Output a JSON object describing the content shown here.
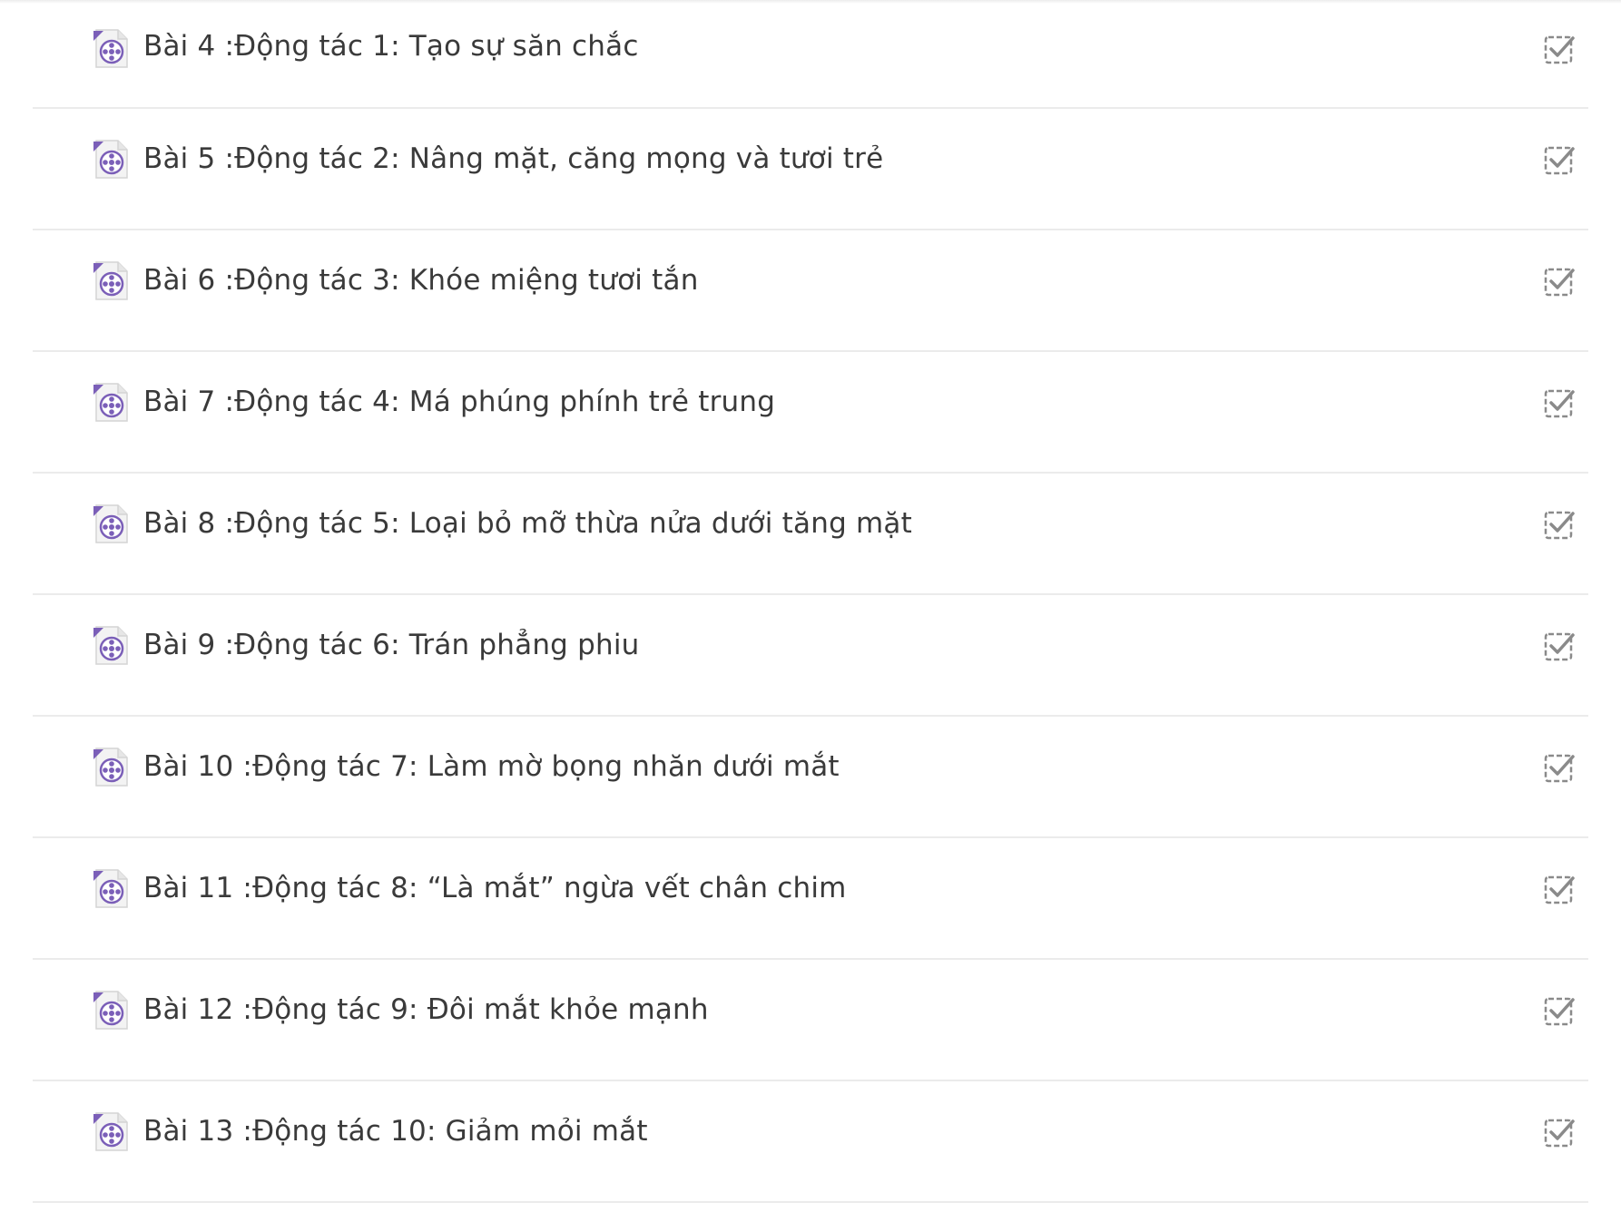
{
  "lessons": [
    {
      "title": "Bài 4 :Động tác 1: Tạo sự săn chắc",
      "type_icon": "video-file-icon",
      "status_icon": "completion-checkbox-icon"
    },
    {
      "title": "Bài 5 :Động tác 2: Nâng mặt, căng mọng và tươi trẻ",
      "type_icon": "video-file-icon",
      "status_icon": "completion-checkbox-icon"
    },
    {
      "title": "Bài 6 :Động tác 3: Khóe miệng tươi tắn",
      "type_icon": "video-file-icon",
      "status_icon": "completion-checkbox-icon"
    },
    {
      "title": "Bài 7 :Động tác 4: Má phúng phính trẻ trung",
      "type_icon": "video-file-icon",
      "status_icon": "completion-checkbox-icon"
    },
    {
      "title": "Bài 8 :Động tác 5: Loại bỏ mỡ thừa nửa dưới tăng mặt",
      "type_icon": "video-file-icon",
      "status_icon": "completion-checkbox-icon"
    },
    {
      "title": "Bài 9 :Động tác 6: Trán phẳng phiu",
      "type_icon": "video-file-icon",
      "status_icon": "completion-checkbox-icon"
    },
    {
      "title": "Bài 10 :Động tác 7: Làm mờ bọng nhăn dưới mắt",
      "type_icon": "video-file-icon",
      "status_icon": "completion-checkbox-icon"
    },
    {
      "title": "Bài 11 :Động tác 8: “Là mắt” ngừa vết chân chim",
      "type_icon": "video-file-icon",
      "status_icon": "completion-checkbox-icon"
    },
    {
      "title": "Bài 12 :Động tác 9: Đôi mắt khỏe mạnh",
      "type_icon": "video-file-icon",
      "status_icon": "completion-checkbox-icon"
    },
    {
      "title": "Bài 13 :Động tác 10: Giảm mỏi mắt",
      "type_icon": "video-file-icon",
      "status_icon": "completion-checkbox-icon"
    }
  ],
  "colors": {
    "text": "#3a3a3a",
    "divider": "#ebebeb",
    "icon_accent": "#7b5fb8",
    "check": "#8a8a8a"
  }
}
